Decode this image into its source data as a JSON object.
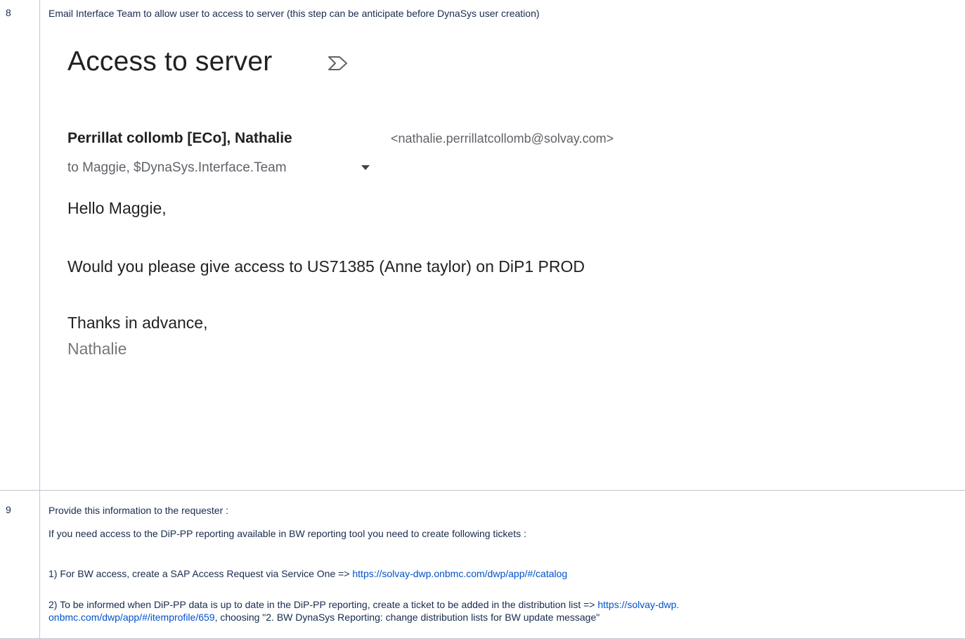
{
  "row8": {
    "number": "8",
    "instruction": "Email Interface Team to allow user to access to server (this step can be anticipate before DynaSys user creation)",
    "email": {
      "subject": "Access to server",
      "sender_name": "Perrillat collomb [ECo], Nathalie",
      "sender_email": "<nathalie.perrillatcollomb@solvay.com>",
      "recipients": "to Maggie, $DynaSys.Interface.Team",
      "greeting": "Hello Maggie,",
      "body": "Would you please give access to  US71385 (Anne taylor) on DiP1 PROD",
      "closing": "Thanks in advance,",
      "signature": "Nathalie"
    }
  },
  "row9": {
    "number": "9",
    "intro": "Provide this information to the requester :",
    "condition": "If you need access to the DiP-PP reporting available in BW reporting tool you need to create following tickets :",
    "item1_text": " 1) For BW access, create a SAP Access Request via Service One => ",
    "item1_link": "https://solvay-dwp.onbmc.com/dwp/app/#/catalog",
    "item2_text": " 2) To be informed when DiP-PP data is up to date in the DiP-PP reporting, create a ticket to be added in the distribution list => ",
    "item2_link_part1": "https://solvay-dwp.",
    "item2_link_part2": "onbmc.com/dwp/app/#/itemprofile/659",
    "item2_suffix": ", choosing \"2. BW DynaSys Reporting: change distribution lists for BW update message\""
  }
}
